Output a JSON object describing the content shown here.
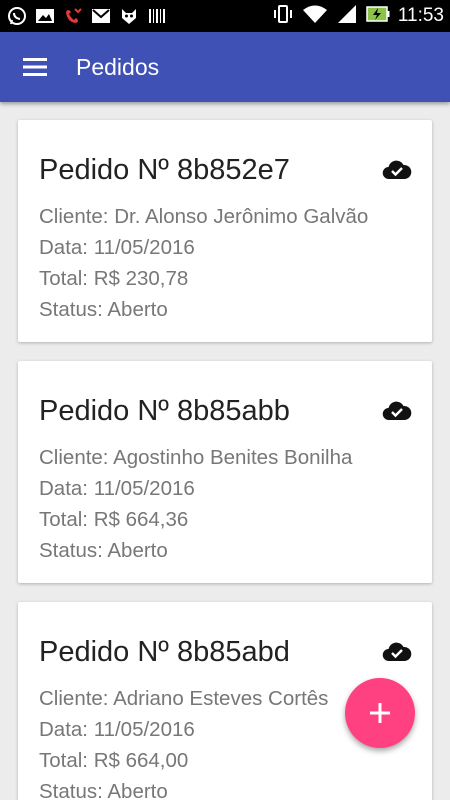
{
  "status_bar": {
    "time": "11:53",
    "left_icons": [
      "whatsapp-icon",
      "image-icon",
      "missed-call-icon",
      "gmail-icon",
      "download-bot-icon",
      "barcode-icon"
    ],
    "right_icons": [
      "vibrate-icon",
      "wifi-icon",
      "signal-icon",
      "battery-charging-icon"
    ]
  },
  "app_bar": {
    "title": "Pedidos",
    "color": "#3f51b5"
  },
  "orders": [
    {
      "title": "Pedido Nº 8b852e7",
      "cliente": "Cliente: Dr. Alonso Jerônimo Galvão",
      "data": "Data: 11/05/2016",
      "total": "Total: R$ 230,78",
      "status": "Status: Aberto",
      "sync_icon": "cloud-done-icon"
    },
    {
      "title": "Pedido Nº 8b85abb",
      "cliente": "Cliente: Agostinho Benites Bonilha",
      "data": "Data: 11/05/2016",
      "total": "Total: R$ 664,36",
      "status": "Status: Aberto",
      "sync_icon": "cloud-done-icon"
    },
    {
      "title": "Pedido Nº 8b85abd",
      "cliente": "Cliente: Adriano Esteves Cortês",
      "data": "Data: 11/05/2016",
      "total": "Total: R$ 664,00",
      "status": "Status: Aberto",
      "sync_icon": "cloud-done-icon"
    }
  ],
  "fab": {
    "icon": "add-icon",
    "color": "#ff4081"
  }
}
